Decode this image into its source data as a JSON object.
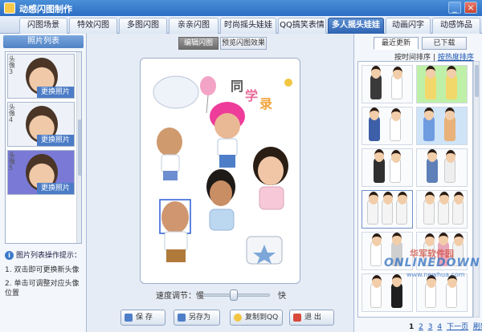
{
  "window": {
    "title": "动感闪图制作"
  },
  "tabs": [
    {
      "label": "闪图场景"
    },
    {
      "label": "特效闪图"
    },
    {
      "label": "多图闪图"
    },
    {
      "label": "亲亲闪图"
    },
    {
      "label": "时尚摇头娃娃"
    },
    {
      "label": "QQ搞笑表情"
    },
    {
      "label": "多人摇头娃娃"
    },
    {
      "label": "动画闪字"
    },
    {
      "label": "动感饰品"
    }
  ],
  "left": {
    "header": "照片列表",
    "thumbs": [
      {
        "num": "头像3",
        "replace": "更换照片"
      },
      {
        "num": "头像4",
        "replace": "更换照片"
      },
      {
        "num": "头像5",
        "replace": "更换照片"
      }
    ],
    "tips": {
      "title": "图片列表操作提示：",
      "line1": "1. 双击即可更换新头像",
      "line2": "2. 单击可调整对应头像位置"
    }
  },
  "center": {
    "tab_edit": "编辑闪图",
    "tab_preview": "预览闪图效果",
    "speed_label": "速度调节：慢",
    "speed_fast": "快",
    "speed_level": 0.45,
    "buttons": {
      "save": "保 存",
      "save_as": "另存为",
      "copy_qq": "复制到QQ",
      "exit": "退 出"
    }
  },
  "right": {
    "tab_recent": "最近更新",
    "tab_downloaded": "已下载",
    "sort_time": "按时间排序",
    "sort_sep": "|",
    "sort_hot": "按热度排序",
    "pager": {
      "p1": "1",
      "p2": "2",
      "p3": "3",
      "p4": "4",
      "next": "下一页",
      "refresh": "刷新"
    }
  },
  "watermark": {
    "cn": "华军软件园",
    "en": "ONLINEDOWN",
    "url": "www.newhua.com"
  },
  "colors": {
    "accent": "#2d63b3",
    "active_tab": "#2d63b3",
    "selected_thumb": "#7a7ad6"
  }
}
